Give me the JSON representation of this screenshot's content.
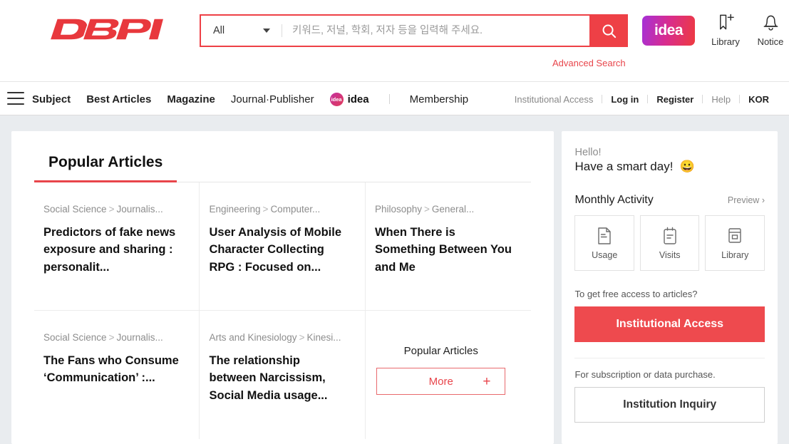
{
  "header": {
    "logo_text": "DBpia",
    "search": {
      "scope_label": "All",
      "scope_icon": "chevron-down-icon",
      "placeholder": "키워드, 저널, 학회, 저자 등을 입력해 주세요.",
      "value": "",
      "search_icon": "search-icon",
      "advanced_label": "Advanced Search"
    },
    "idea_badge_label": "idea",
    "icons": [
      {
        "name": "library-bookmark-add-icon",
        "label": "Library"
      },
      {
        "name": "notice-bell-icon",
        "label": "Notice"
      }
    ]
  },
  "nav": {
    "menu_icon": "hamburger-menu-icon",
    "left_items": [
      {
        "label": "Subject",
        "bold": true
      },
      {
        "label": "Best Articles",
        "bold": true
      },
      {
        "label": "Magazine",
        "bold": true
      },
      {
        "label": "Journal·Publisher",
        "bold": false
      }
    ],
    "idea_item": {
      "label": "idea",
      "badge_text": "idea"
    },
    "membership_label": "Membership",
    "right_items": [
      {
        "label": "Institutional Access",
        "strong": false
      },
      {
        "label": "Log in",
        "strong": true
      },
      {
        "label": "Register",
        "strong": true
      },
      {
        "label": "Help",
        "strong": false
      },
      {
        "label": "KOR",
        "strong": false
      }
    ]
  },
  "main": {
    "tabs": [
      {
        "label": "Popular Articles",
        "active": true
      }
    ],
    "articles": [
      {
        "category_main": "Social Science",
        "category_sub": "Journalis...",
        "title": "Predictors of fake news exposure and sharing : personalit..."
      },
      {
        "category_main": "Engineering",
        "category_sub": "Computer...",
        "title": "User Analysis of Mobile Character Collecting RPG : Focused on..."
      },
      {
        "category_main": "Philosophy",
        "category_sub": "General...",
        "title": "When There is Something Between You and Me"
      },
      {
        "category_main": "Social Science",
        "category_sub": "Journalis...",
        "title": "The Fans who Consume ‘Communication’ :..."
      },
      {
        "category_main": "Arts and Kinesiology",
        "category_sub": "Kinesi...",
        "title": "The relationship between Narcissism, Social Media usage..."
      }
    ],
    "more_panel": {
      "label": "Popular Articles",
      "button_label": "More",
      "plus_icon": "plus-icon"
    }
  },
  "sidebar": {
    "greeting": "Hello!",
    "greeting_sub": "Have a smart day!",
    "greeting_emoji": "😀",
    "activity_title": "Monthly Activity",
    "preview_label": "Preview",
    "preview_icon": "chevron-right-icon",
    "activity_boxes": [
      {
        "icon": "document-usage-icon",
        "label": "Usage"
      },
      {
        "icon": "clipboard-visits-icon",
        "label": "Visits"
      },
      {
        "icon": "library-book-icon",
        "label": "Library"
      }
    ],
    "free_access_note": "To get free access to articles?",
    "institutional_access_label": "Institutional Access",
    "subscription_note": "For subscription or data purchase.",
    "institution_inquiry_label": "Institution Inquiry"
  },
  "colors": {
    "brand_red": "#ee4046",
    "accent_red": "#e8454b",
    "page_bg": "#e9ecef"
  }
}
